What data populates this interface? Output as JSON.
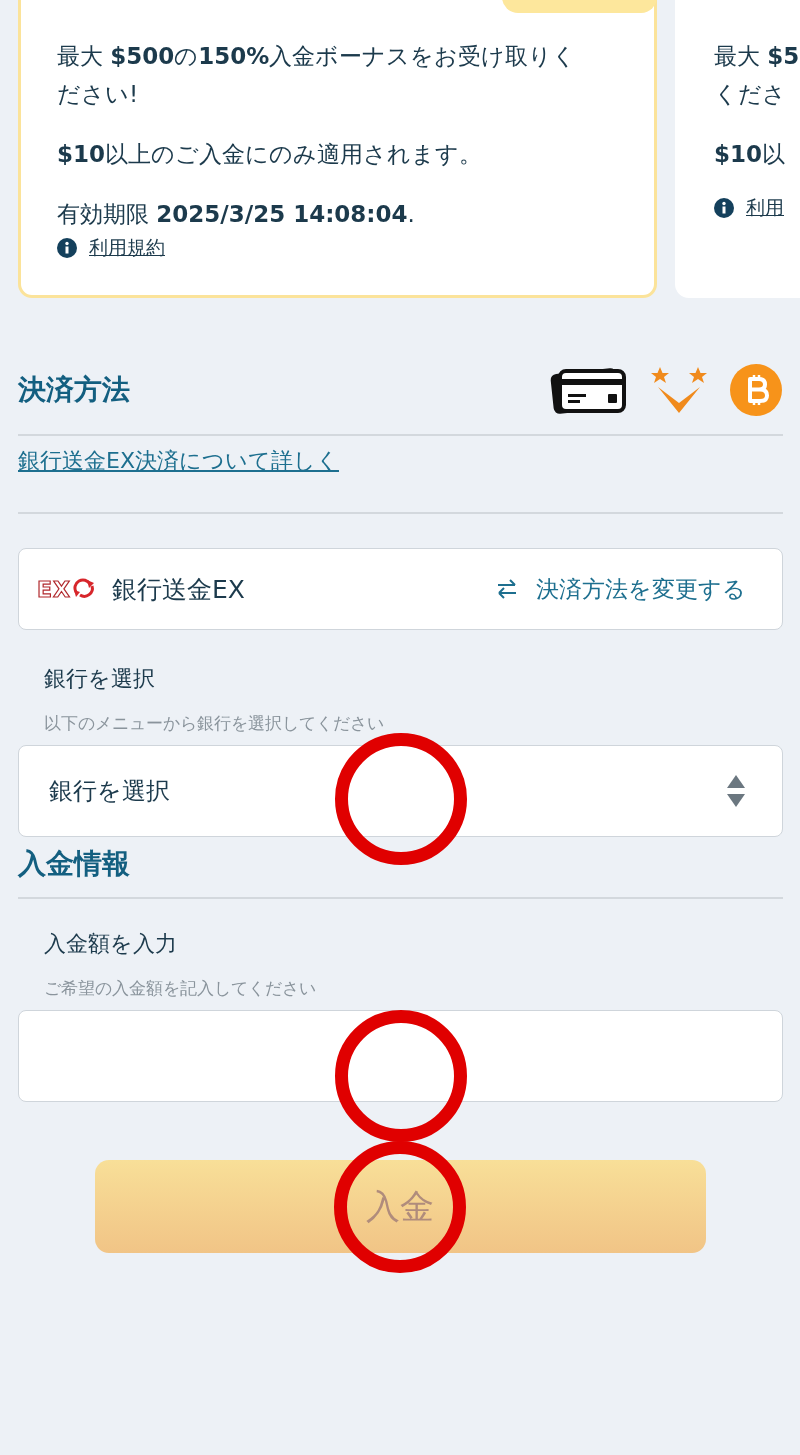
{
  "bonus_cards": [
    {
      "selected": true,
      "offer": "最大 **$500**の**150%**入金ボーナスをお受け取りください!",
      "condition": "**$10**以上のご入金にのみ適用されます。",
      "expiry": "有効期限 **2025/3/25 14:08:04**.",
      "terms": "利用規約"
    },
    {
      "selected": false,
      "offer": "最大 **$5**",
      "offer_2": "くださ",
      "condition": "**$10**以",
      "terms": "利用"
    }
  ],
  "payment_section": {
    "title": "決済方法",
    "info_link": "銀行送金EX決済について詳しく",
    "method": {
      "logo_text": "EX",
      "name": "銀行送金EX",
      "change_label": "決済方法を変更する"
    },
    "bank_field": {
      "label": "銀行を選択",
      "hint": "以下のメニューから銀行を選択してください",
      "value": "銀行を選択"
    }
  },
  "deposit_section": {
    "title": "入金情報",
    "amount_field": {
      "label": "入金額を入力",
      "hint": "ご希望の入金額を記入してください"
    },
    "submit": {
      "label": "入金",
      "disabled": true
    }
  },
  "marks": [
    {
      "kind": "ring"
    },
    {
      "kind": "ring"
    },
    {
      "kind": "ring"
    }
  ]
}
